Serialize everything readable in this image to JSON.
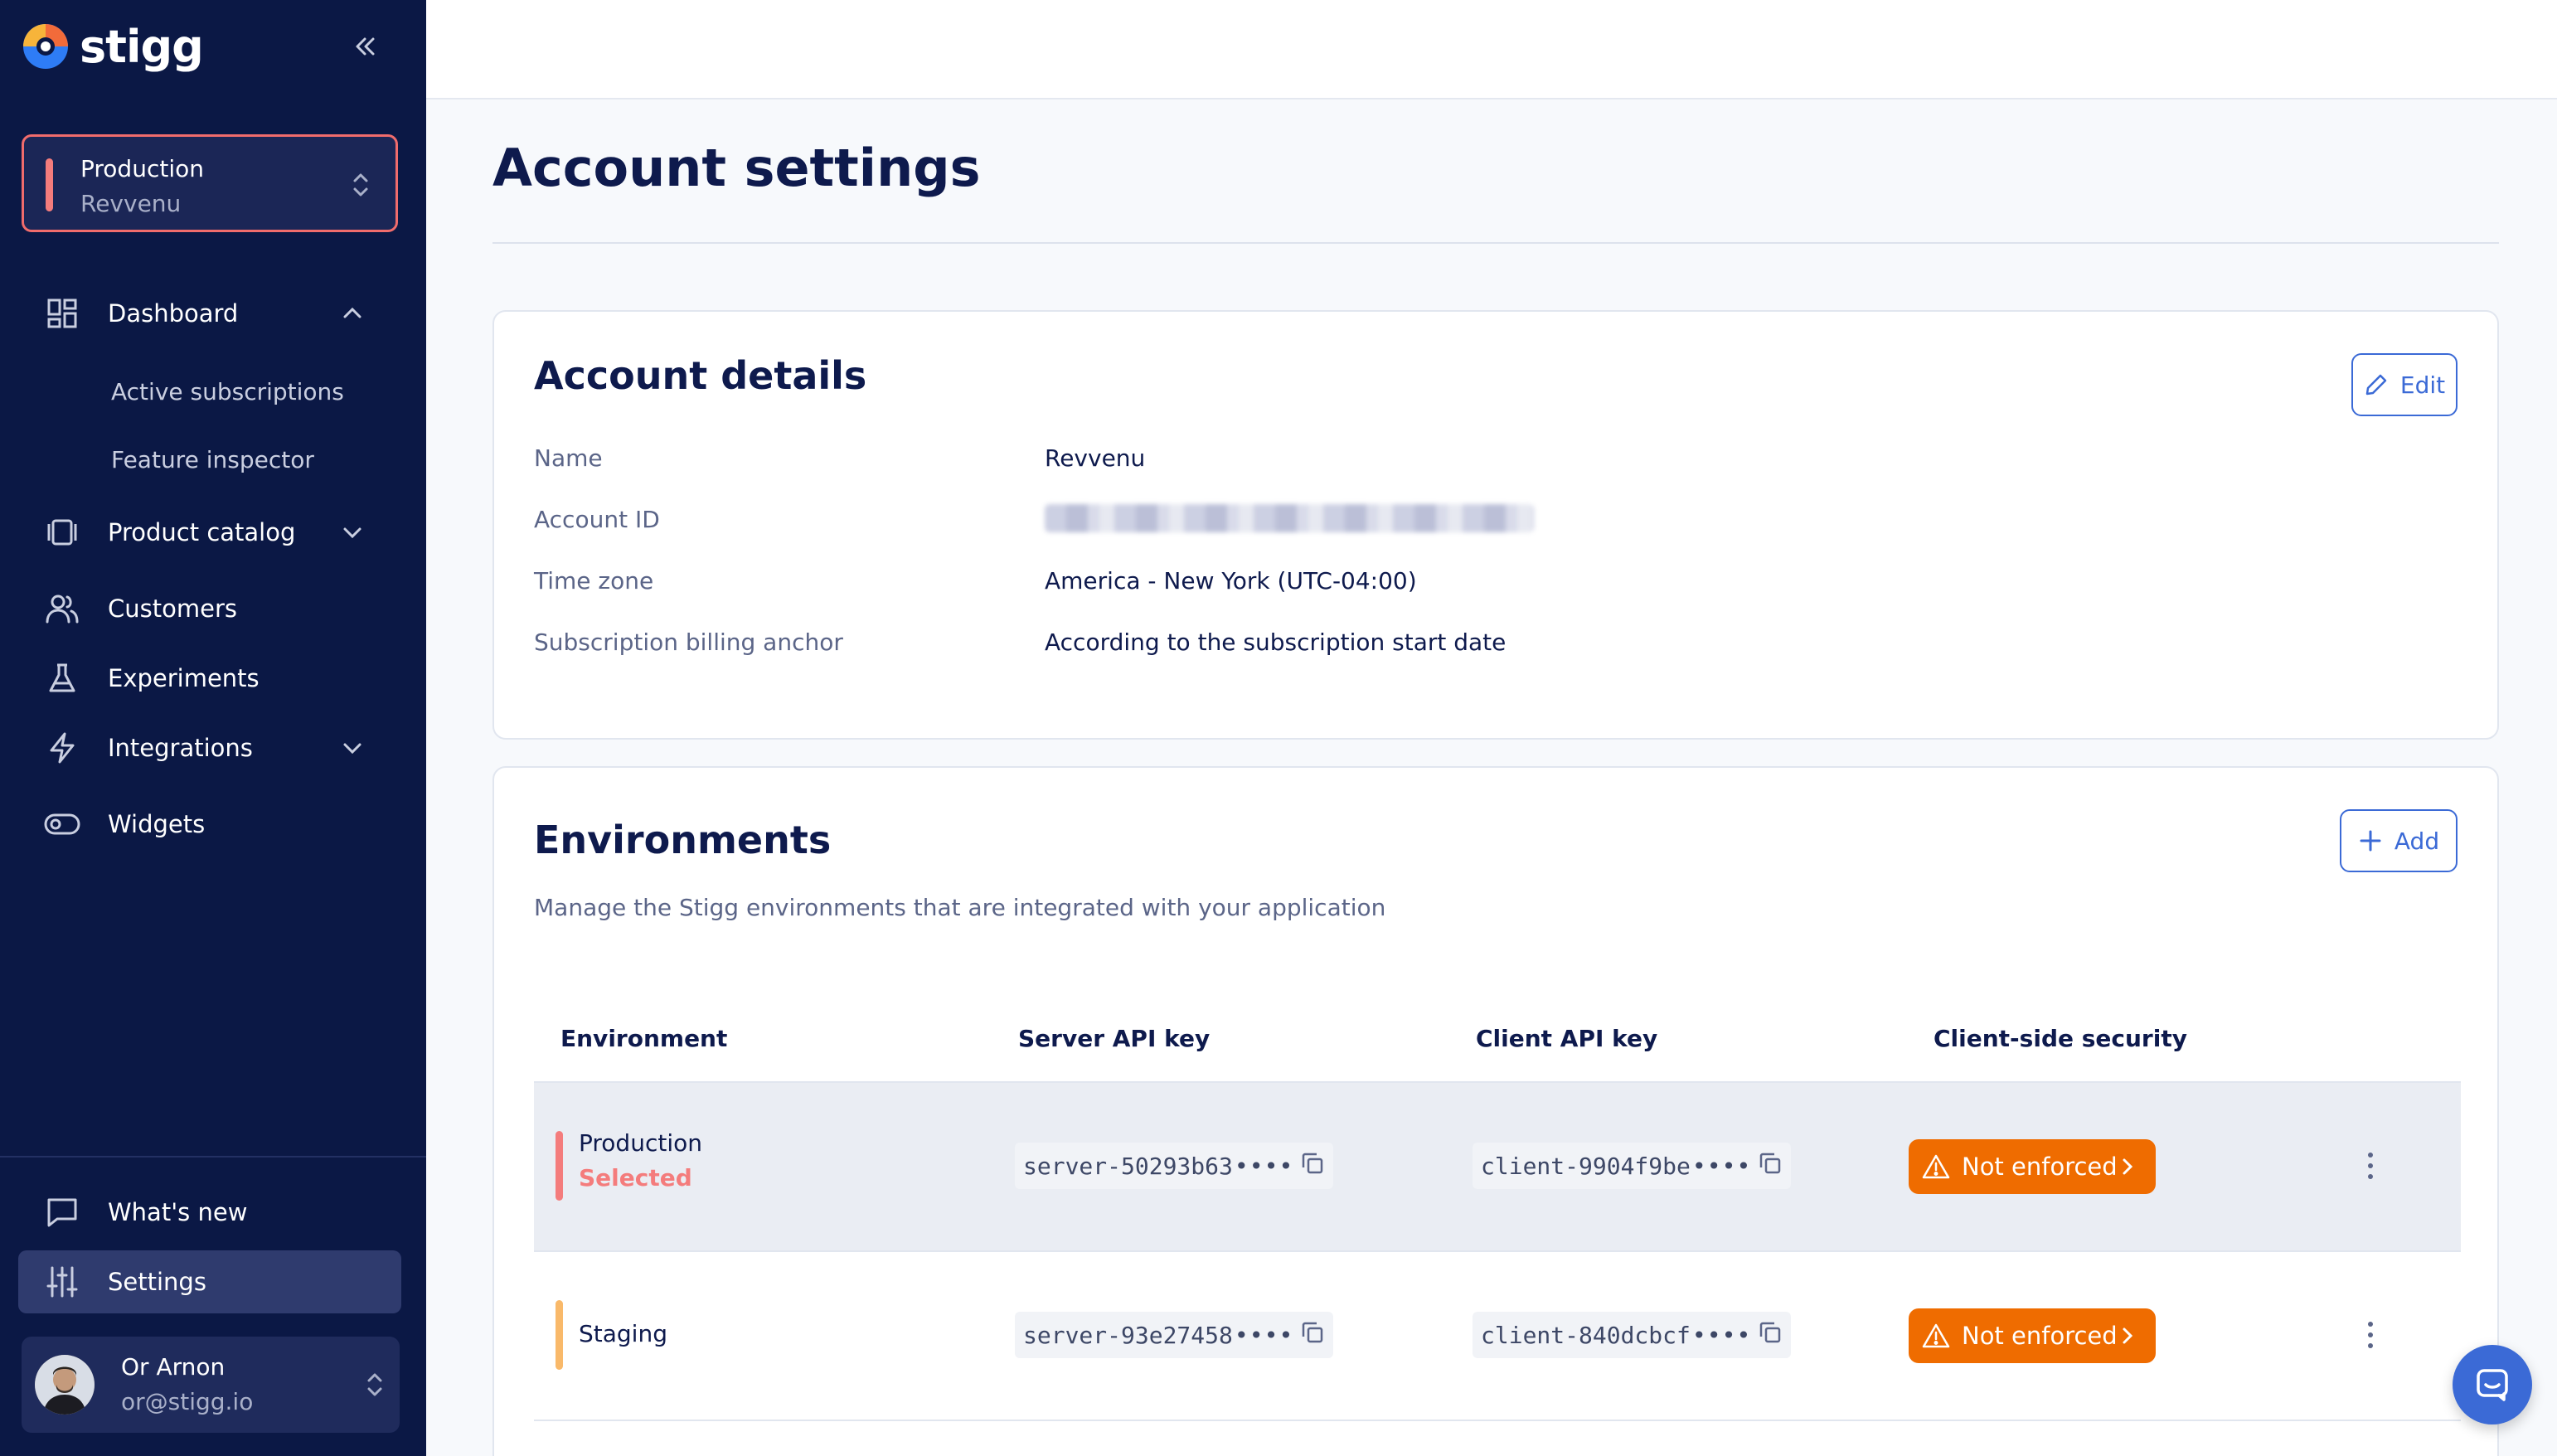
{
  "app": {
    "name": "stigg"
  },
  "env_switcher": {
    "environment": "Production",
    "account": "Revvenu"
  },
  "nav": {
    "dashboard": "Dashboard",
    "active_subscriptions": "Active subscriptions",
    "feature_inspector": "Feature inspector",
    "product_catalog": "Product catalog",
    "customers": "Customers",
    "experiments": "Experiments",
    "integrations": "Integrations",
    "widgets": "Widgets",
    "whats_new": "What's new",
    "settings": "Settings"
  },
  "user": {
    "name": "Or Arnon",
    "email": "or@stigg.io"
  },
  "page": {
    "title": "Account settings"
  },
  "account_details": {
    "title": "Account details",
    "edit_label": "Edit",
    "fields": [
      {
        "label": "Name",
        "value": "Revvenu"
      },
      {
        "label": "Account ID",
        "value": ""
      },
      {
        "label": "Time zone",
        "value": "America - New York (UTC-04:00)"
      },
      {
        "label": "Subscription billing anchor",
        "value": "According to the subscription start date"
      }
    ]
  },
  "environments": {
    "title": "Environments",
    "add_label": "Add",
    "description": "Manage the Stigg environments that are integrated with your application",
    "columns": [
      "Environment",
      "Server API key",
      "Client API key",
      "Client-side security"
    ],
    "rows": [
      {
        "name": "Production",
        "selected_label": "Selected",
        "server_key": "server-50293b63",
        "client_key": "client-9904f9be",
        "security": "Not enforced",
        "bar_color": "#f47c7c"
      },
      {
        "name": "Staging",
        "selected_label": "",
        "server_key": "server-93e27458",
        "client_key": "client-840dcbcf",
        "security": "Not enforced",
        "bar_color": "#f9b96a"
      }
    ],
    "masked_suffix": "••••"
  },
  "colors": {
    "sidebar": "#0b1845",
    "accent": "#3b6ad6",
    "warning": "#ef6c00",
    "production": "#f47c7c",
    "staging": "#f9b96a"
  }
}
